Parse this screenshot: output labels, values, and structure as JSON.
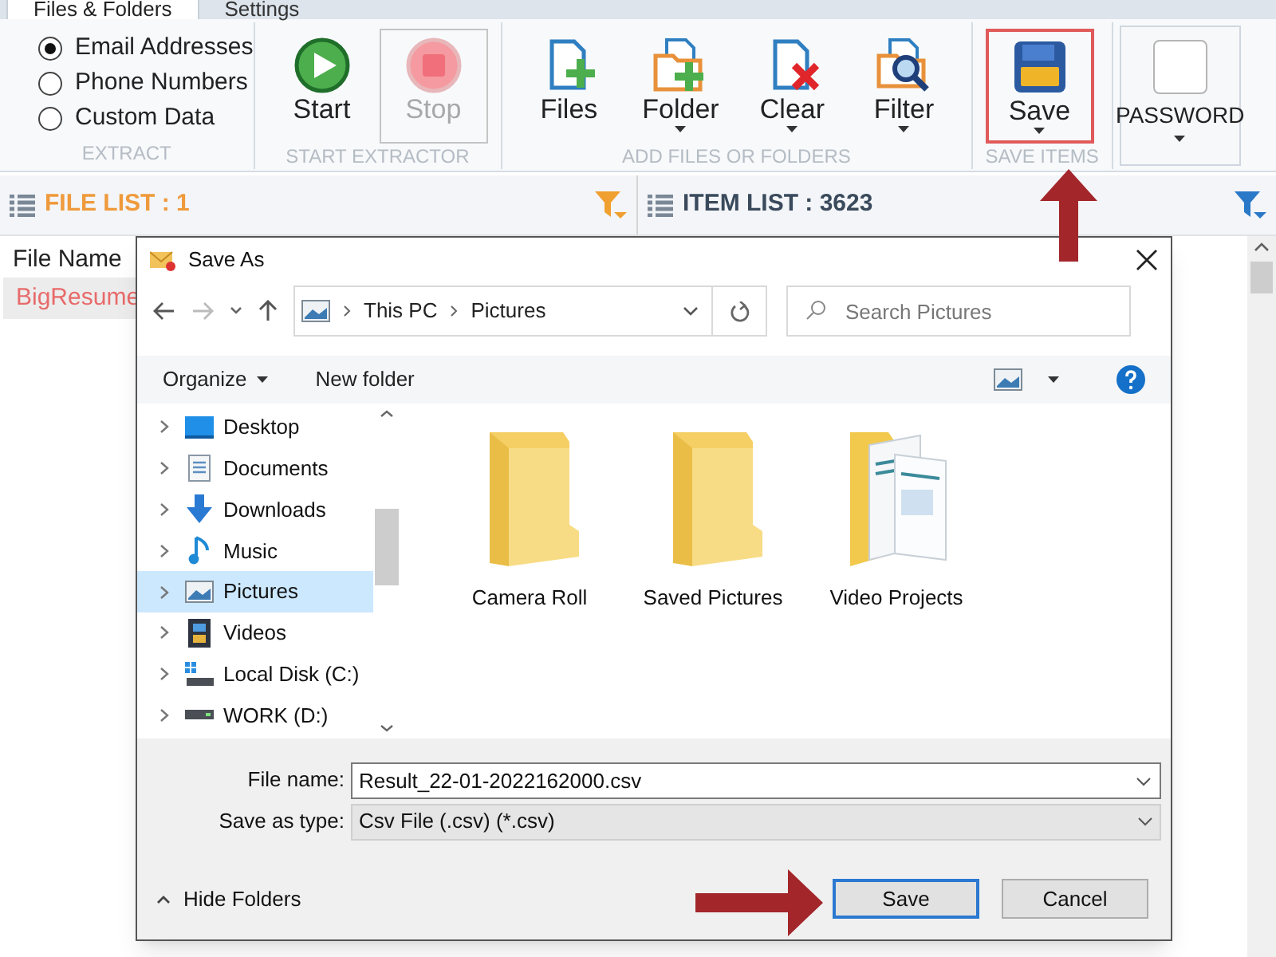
{
  "app_tabs": [
    {
      "label": "Files & Folders",
      "selected": true
    },
    {
      "label": "Settings",
      "selected": false
    }
  ],
  "ribbon": {
    "groups": [
      {
        "label": "EXTRACT",
        "kind": "radios",
        "options": [
          {
            "label": "Email Addresses",
            "selected": true
          },
          {
            "label": "Phone Numbers",
            "selected": false
          },
          {
            "label": "Custom Data",
            "selected": false
          }
        ]
      },
      {
        "label": "START EXTRACTOR",
        "kind": "buttons",
        "buttons": [
          {
            "kind": "start",
            "label": "Start",
            "disabled": false,
            "dropdown": false,
            "highlighted": false
          },
          {
            "kind": "stop",
            "label": "Stop",
            "disabled": true,
            "dropdown": false,
            "highlighted": false
          }
        ]
      },
      {
        "label": "ADD FILES OR FOLDERS",
        "kind": "buttons",
        "buttons": [
          {
            "kind": "files",
            "label": "Files",
            "disabled": false,
            "dropdown": false,
            "highlighted": false
          },
          {
            "kind": "folder",
            "label": "Folder",
            "disabled": false,
            "dropdown": true,
            "highlighted": false
          },
          {
            "kind": "clear",
            "label": "Clear",
            "disabled": false,
            "dropdown": true,
            "highlighted": false
          },
          {
            "kind": "filter",
            "label": "Filter",
            "disabled": false,
            "dropdown": true,
            "highlighted": false
          }
        ]
      },
      {
        "label": "SAVE ITEMS",
        "kind": "buttons",
        "buttons": [
          {
            "kind": "save",
            "label": "Save",
            "disabled": false,
            "dropdown": true,
            "highlighted": true
          }
        ]
      },
      {
        "kind": "password",
        "label": "PASSWORD",
        "dropdown": true
      }
    ]
  },
  "file_list": {
    "title": "FILE LIST : 1",
    "column": "File Name",
    "rows": [
      "BigResume"
    ]
  },
  "item_list": {
    "title": "ITEM LIST : 3623"
  },
  "dialog": {
    "title": "Save As",
    "address": [
      "This PC",
      "Pictures"
    ],
    "search": {
      "placeholder": "Search Pictures"
    },
    "toolbar": {
      "organize": "Organize",
      "new_folder": "New folder"
    },
    "tree": [
      {
        "kind": "desktop",
        "label": "Desktop",
        "selected": false
      },
      {
        "kind": "documents",
        "label": "Documents",
        "selected": false
      },
      {
        "kind": "downloads",
        "label": "Downloads",
        "selected": false
      },
      {
        "kind": "music",
        "label": "Music",
        "selected": false
      },
      {
        "kind": "pictures",
        "label": "Pictures",
        "selected": true
      },
      {
        "kind": "videos",
        "label": "Videos",
        "selected": false
      },
      {
        "kind": "disk",
        "label": "Local Disk (C:)",
        "selected": false
      },
      {
        "kind": "drive",
        "label": "WORK (D:)",
        "selected": false
      }
    ],
    "folders": [
      {
        "kind": "folder",
        "label": "Camera Roll"
      },
      {
        "kind": "folder",
        "label": "Saved Pictures"
      },
      {
        "kind": "documents",
        "label": "Video Projects"
      }
    ],
    "file_name": {
      "label": "File name:",
      "value": "Result_22-01-2022162000.csv"
    },
    "file_type": {
      "label": "Save as type:",
      "value": "Csv File (.csv) (*.csv)"
    },
    "hide_folders": "Hide Folders",
    "buttons": [
      {
        "label": "Save",
        "default": true
      },
      {
        "label": "Cancel",
        "default": false
      }
    ]
  }
}
